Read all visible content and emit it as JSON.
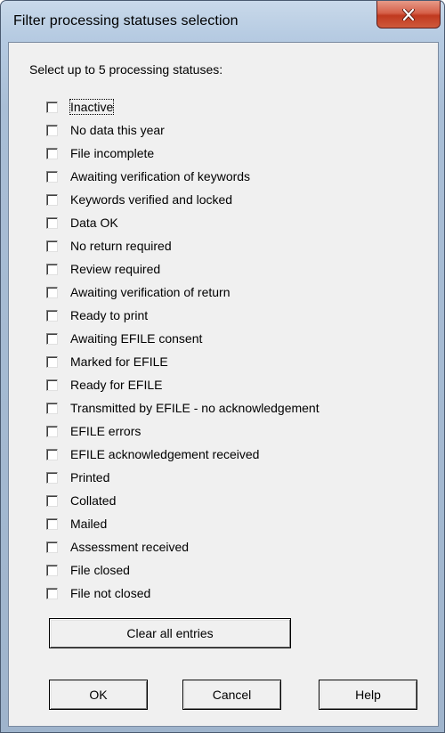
{
  "window": {
    "title": "Filter processing statuses selection",
    "close_icon": "close-icon"
  },
  "dialog": {
    "prompt": "Select up to 5 processing statuses:",
    "statuses": [
      {
        "label": "Inactive",
        "checked": false
      },
      {
        "label": "No data this year",
        "checked": false
      },
      {
        "label": "File incomplete",
        "checked": false
      },
      {
        "label": "Awaiting verification of keywords",
        "checked": false
      },
      {
        "label": "Keywords verified and locked",
        "checked": false
      },
      {
        "label": "Data OK",
        "checked": false
      },
      {
        "label": "No return required",
        "checked": false
      },
      {
        "label": "Review required",
        "checked": false
      },
      {
        "label": "Awaiting verification of return",
        "checked": false
      },
      {
        "label": "Ready to print",
        "checked": false
      },
      {
        "label": "Awaiting EFILE consent",
        "checked": false
      },
      {
        "label": "Marked for EFILE",
        "checked": false
      },
      {
        "label": "Ready for EFILE",
        "checked": false
      },
      {
        "label": "Transmitted by EFILE - no acknowledgement",
        "checked": false
      },
      {
        "label": "EFILE errors",
        "checked": false
      },
      {
        "label": "EFILE acknowledgement received",
        "checked": false
      },
      {
        "label": "Printed",
        "checked": false
      },
      {
        "label": "Collated",
        "checked": false
      },
      {
        "label": "Mailed",
        "checked": false
      },
      {
        "label": "Assessment received",
        "checked": false
      },
      {
        "label": "File closed",
        "checked": false
      },
      {
        "label": "File not closed",
        "checked": false
      }
    ],
    "clear_label": "Clear all entries"
  },
  "buttons": {
    "ok": "OK",
    "cancel": "Cancel",
    "help": "Help"
  },
  "colors": {
    "close_button": "#c9452a",
    "client_background": "#f0f0f0",
    "frame": "#b6cbe2"
  }
}
